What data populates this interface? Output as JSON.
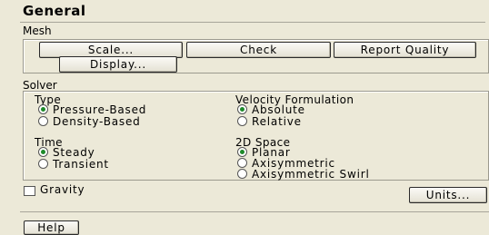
{
  "panel": {
    "title": "General"
  },
  "mesh": {
    "label": "Mesh",
    "buttons": {
      "scale": "Scale...",
      "check": "Check",
      "report_quality": "Report Quality",
      "display": "Display..."
    }
  },
  "solver": {
    "label": "Solver",
    "type": {
      "label": "Type",
      "options": [
        "Pressure-Based",
        "Density-Based"
      ],
      "selected": "Pressure-Based"
    },
    "velocity_formulation": {
      "label": "Velocity Formulation",
      "options": [
        "Absolute",
        "Relative"
      ],
      "selected": "Absolute"
    },
    "time": {
      "label": "Time",
      "options": [
        "Steady",
        "Transient"
      ],
      "selected": "Steady"
    },
    "space_2d": {
      "label": "2D Space",
      "options": [
        "Planar",
        "Axisymmetric",
        "Axisymmetric Swirl"
      ],
      "selected": "Planar"
    }
  },
  "gravity": {
    "label": "Gravity",
    "checked": false
  },
  "units_button": "Units...",
  "help_button": "Help",
  "colors": {
    "background": "#ece9d8",
    "radio_selected": "#1e8a2a"
  }
}
